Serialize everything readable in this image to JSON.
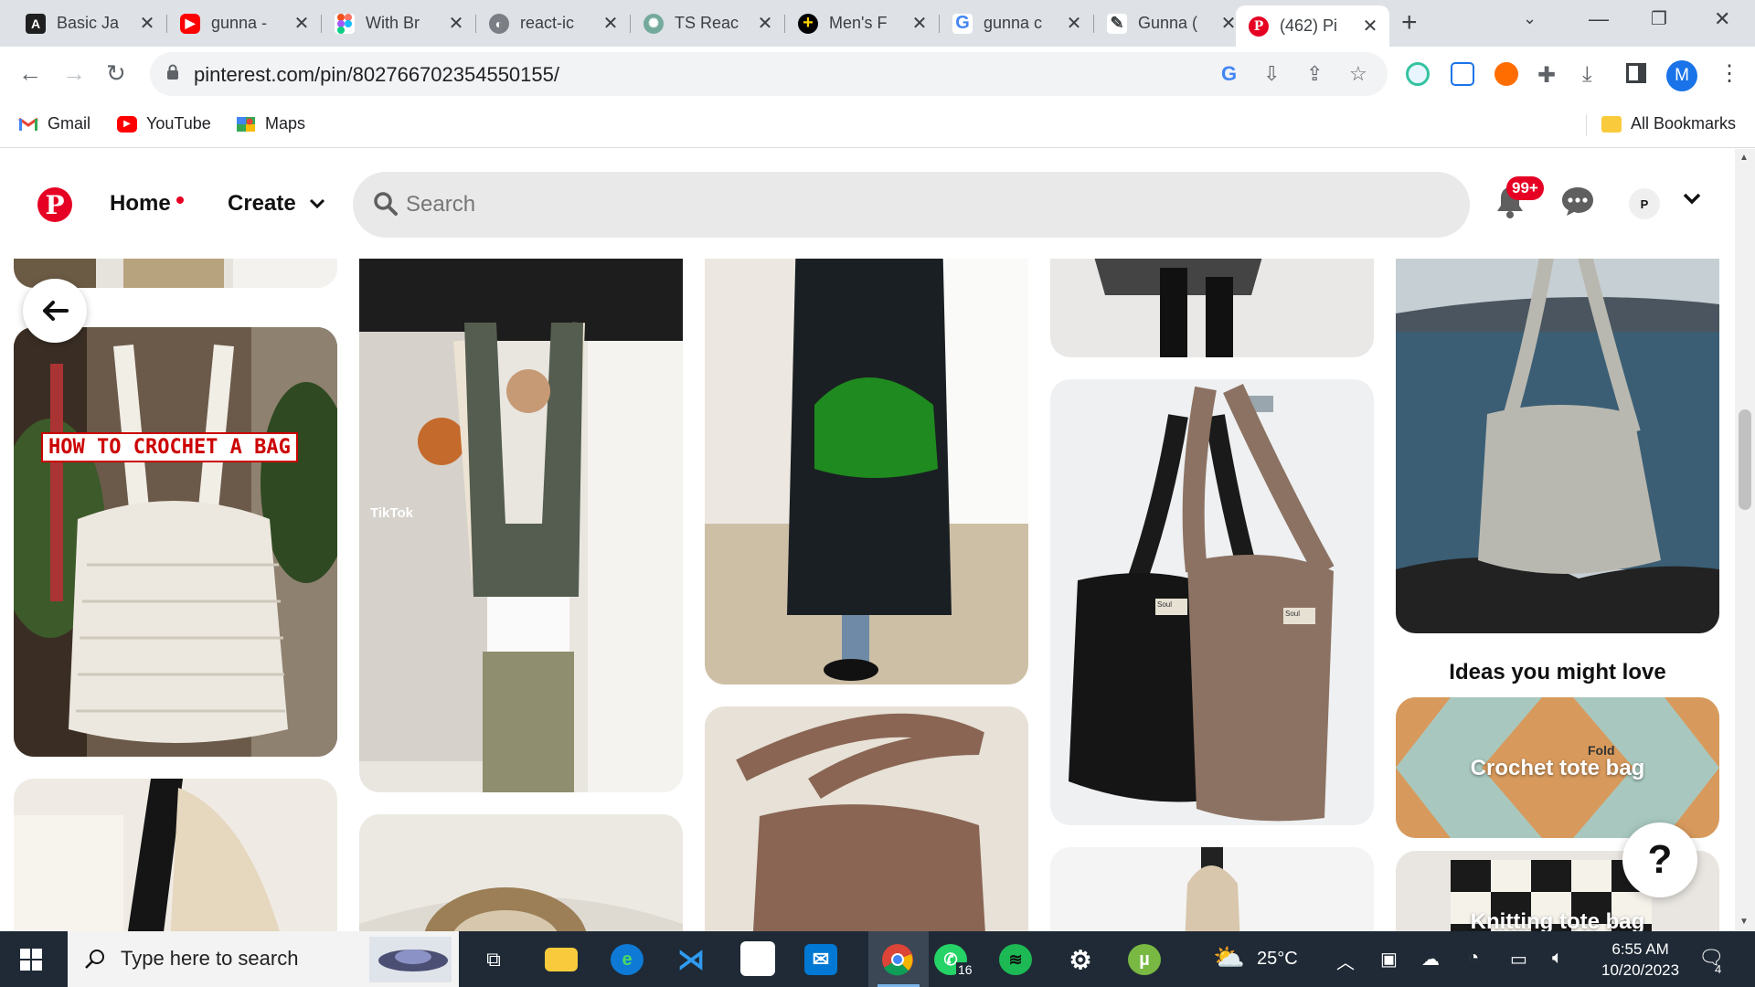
{
  "browser": {
    "tabs": [
      {
        "label": "Basic Ja",
        "icon": "code-academy-icon",
        "color": "#1f1f1f"
      },
      {
        "label": "gunna -",
        "icon": "youtube-icon",
        "color": "#ff0000"
      },
      {
        "label": "With Br",
        "icon": "figma-icon",
        "color": "#f24e1e"
      },
      {
        "label": "react-ic",
        "icon": "globe-icon",
        "color": "#5f6368"
      },
      {
        "label": "TS Reac",
        "icon": "chatgpt-icon",
        "color": "#74aa9c"
      },
      {
        "label": "Men's F",
        "icon": "plus-circle-icon",
        "color": "#000000"
      },
      {
        "label": "gunna c",
        "icon": "google-icon",
        "color": "#4285f4"
      },
      {
        "label": "Gunna (",
        "icon": "genius-icon",
        "color": "#3c4043"
      },
      {
        "label": "(462) Pi",
        "icon": "pinterest-icon",
        "color": "#e60023"
      }
    ],
    "url": "pinterest.com/pin/802766702354550155/",
    "profile_initial": "M",
    "bookmarks": [
      {
        "label": "Gmail",
        "icon": "gmail-icon"
      },
      {
        "label": "YouTube",
        "icon": "youtube-icon"
      },
      {
        "label": "Maps",
        "icon": "maps-icon"
      }
    ],
    "all_bookmarks": "All Bookmarks"
  },
  "pinterest": {
    "nav": {
      "home": "Home",
      "create": "Create"
    },
    "search_placeholder": "Search",
    "notifications_badge": "99+",
    "profile_initial": "P",
    "brand_color": "#e60023",
    "pins": {
      "crochet_title": "HOW TO CROCHET A BAG",
      "tiktok_watermark": "TikTok",
      "bag_tag_1": "Soul",
      "bag_tag_2": "Soul",
      "fold_text": "Fold"
    },
    "ideas_heading": "Ideas you might love",
    "ideas": [
      {
        "label": "Crochet tote bag"
      },
      {
        "label": "Knitting tote bag"
      }
    ],
    "help_label": "?"
  },
  "taskbar": {
    "search_placeholder": "Type here to search",
    "whatsapp_badge": "16",
    "weather": "25°C",
    "time": "6:55 AM",
    "date": "10/20/2023",
    "notifications_count": "4"
  }
}
